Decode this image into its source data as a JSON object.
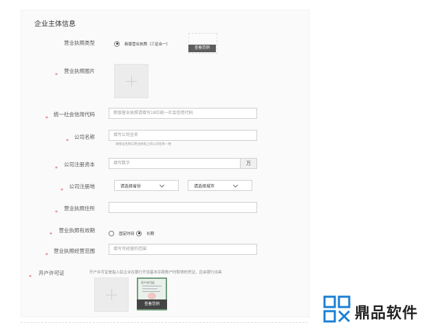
{
  "section_title": "企业主体信息",
  "fields": {
    "license_type": {
      "label": "营业执照类型",
      "option": "新版营业执照（三证合一）",
      "sample": "查看范例"
    },
    "license_image": {
      "label": "营业执照图片"
    },
    "credit_code": {
      "label": "统一社会信用代码",
      "placeholder": "新版营业执照请填写18位统一社会信用代码"
    },
    "company_name": {
      "label": "公司名称",
      "placeholder": "填写公司全名",
      "hint": "请保证名称与营业执照上的公司名称一致"
    },
    "capital": {
      "label": "公司注册资本",
      "placeholder": "填写数字",
      "unit": "万"
    },
    "location": {
      "label": "公司注册地",
      "province": "请选择省份",
      "city": "请选择城市"
    },
    "address": {
      "label": "营业执照住所"
    },
    "validity": {
      "label": "营业执照有效期",
      "fixed": "固定时间",
      "long": "长期"
    },
    "scope": {
      "label": "营业执照经营范围",
      "placeholder": "填写可经营的范围"
    },
    "permit": {
      "label": "开户许可证",
      "desc": "开户许可证是指入驻企业在银行开设基本存款账户时取得的凭证，应由银行出具",
      "sample": "查看范例",
      "doc_title": "开户许可证"
    }
  },
  "star": "*",
  "watermark": {
    "text": "鼎品软件",
    "color": "#1a7fd4"
  }
}
